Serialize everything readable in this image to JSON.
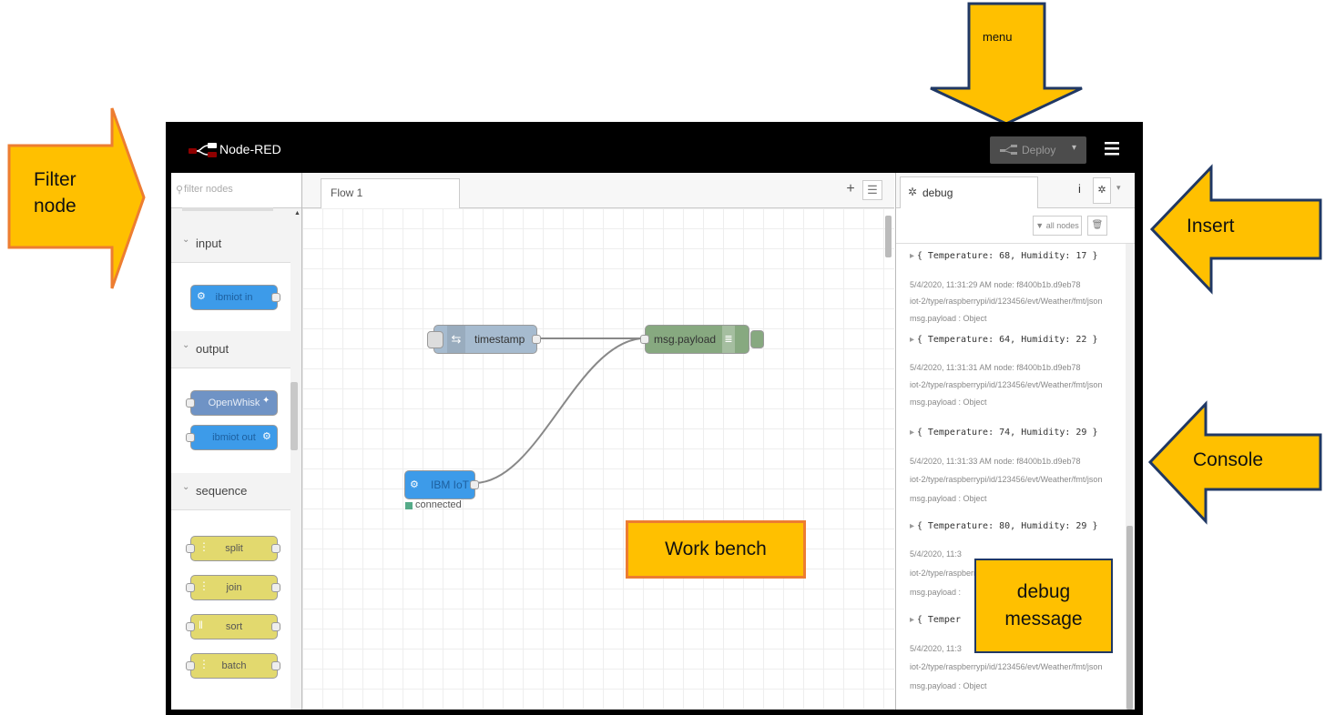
{
  "app": {
    "logo_text": "Node-RED",
    "deploy_label": "Deploy"
  },
  "palette": {
    "filter_placeholder": "filter nodes",
    "categories": [
      {
        "label": "input",
        "nodes": [
          "ibmiot in"
        ]
      },
      {
        "label": "output",
        "nodes": [
          "OpenWhisk",
          "ibmiot out"
        ]
      },
      {
        "label": "sequence",
        "nodes": [
          "split",
          "join",
          "sort",
          "batch"
        ]
      }
    ]
  },
  "workspace": {
    "tab_label": "Flow 1",
    "nodes": {
      "timestamp": "timestamp",
      "debug": "msg.payload",
      "ibmiot": "IBM IoT",
      "status": "connected"
    }
  },
  "sidebar": {
    "tab_label": "debug",
    "filter_label": "all nodes",
    "messages": [
      {
        "payload": "{ Temperature: 68, Humidity: 17 }"
      },
      {
        "meta": "5/4/2020, 11:31:29 AM   node: f8400b1b.d9eb78",
        "topic": "iot-2/type/raspberrypi/id/123456/evt/Weather/fmt/json",
        "label": "msg.payload : Object",
        "payload": "{ Temperature: 64, Humidity: 22 }"
      },
      {
        "meta": "5/4/2020, 11:31:31 AM   node: f8400b1b.d9eb78",
        "topic": "iot-2/type/raspberrypi/id/123456/evt/Weather/fmt/json",
        "label": "msg.payload : Object",
        "payload": "{ Temperature: 74, Humidity: 29 }"
      },
      {
        "meta": "5/4/2020, 11:31:33 AM   node: f8400b1b.d9eb78",
        "topic": "iot-2/type/raspberrypi/id/123456/evt/Weather/fmt/json",
        "label": "msg.payload : Object",
        "payload": "{ Temperature: 80, Humidity: 29 }"
      },
      {
        "meta": "5/4/2020, 11:3",
        "topic": "iot-2/type/raspberrypi",
        "label": "msg.payload : ",
        "payload": "{ Temper"
      },
      {
        "meta": "5/4/2020, 11:3",
        "topic": "iot-2/type/raspberrypi/id/123456/evt/Weather/fmt/json",
        "label": "msg.payload : Object"
      }
    ]
  },
  "callouts": {
    "menu": "menu",
    "filter_node": [
      "Filter",
      "node"
    ],
    "insert": "Insert",
    "console": "Console",
    "work_bench": "Work bench",
    "debug_message": [
      "debug",
      "message"
    ]
  },
  "colors": {
    "callout_fill": "#ffc000",
    "callout_border_blue": "#203864",
    "callout_border_orange": "#ed7d31",
    "node_blue": "#3d9be9",
    "node_green": "#87a980",
    "node_lightblue": "#a6bbcf",
    "node_yellow": "#e2d96e",
    "node_steel": "#6f93c5"
  }
}
